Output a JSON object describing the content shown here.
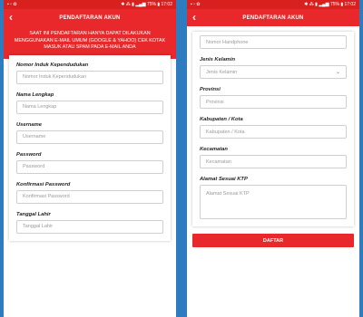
{
  "statusbar": {
    "left_icons": "▪ ▫ ✿",
    "right_text": "✱ ⁂ ▮ ▂▄▆ 75% ▮ 17:02"
  },
  "header": {
    "title": "PENDAFTARAN AKUN",
    "back_symbol": "‹"
  },
  "notice": "SAAT INI PENDAFTARAN HANYA DAPAT DILAKUKAN MENGGUNAKAN E-MAIL UMUM (GOOGLE & YAHOO) CEK KOTAK MASUK ATAU SPAM PADA E-MAIL ANDA",
  "left_form": {
    "nik": {
      "label": "Nomor Induk Kependudukan",
      "placeholder": "Nomor Induk Kependudukan"
    },
    "nama": {
      "label": "Nama Lengkap",
      "placeholder": "Nama Lengkap"
    },
    "username": {
      "label": "Username",
      "placeholder": "Username"
    },
    "password": {
      "label": "Password",
      "placeholder": "Password"
    },
    "konfirmasi": {
      "label": "Konfirmasi Password",
      "placeholder": "Konfirmasi Password"
    },
    "tanggal": {
      "label": "Tanggal Lahir",
      "placeholder": "Tanggal Lahir"
    }
  },
  "right_form": {
    "handphone": {
      "placeholder": "Nomor Handphone"
    },
    "jenis_kelamin": {
      "label": "Jenis Kelamin",
      "value": "Jenis Kelamin"
    },
    "provinsi": {
      "label": "Provinsi",
      "placeholder": "Provinsi"
    },
    "kabupaten": {
      "label": "Kabupaten / Kota",
      "placeholder": "Kabupaten / Kota"
    },
    "kecamatan": {
      "label": "Kecamatan",
      "placeholder": "Kecamatan"
    },
    "alamat": {
      "label": "Alamat Sesuai KTP",
      "placeholder": "Alamat Sesuai KTP"
    },
    "submit_label": "DAFTAR"
  },
  "colors": {
    "primary": "#e8282a",
    "statusbar": "#d8201f",
    "background": "#2c7cbf"
  }
}
